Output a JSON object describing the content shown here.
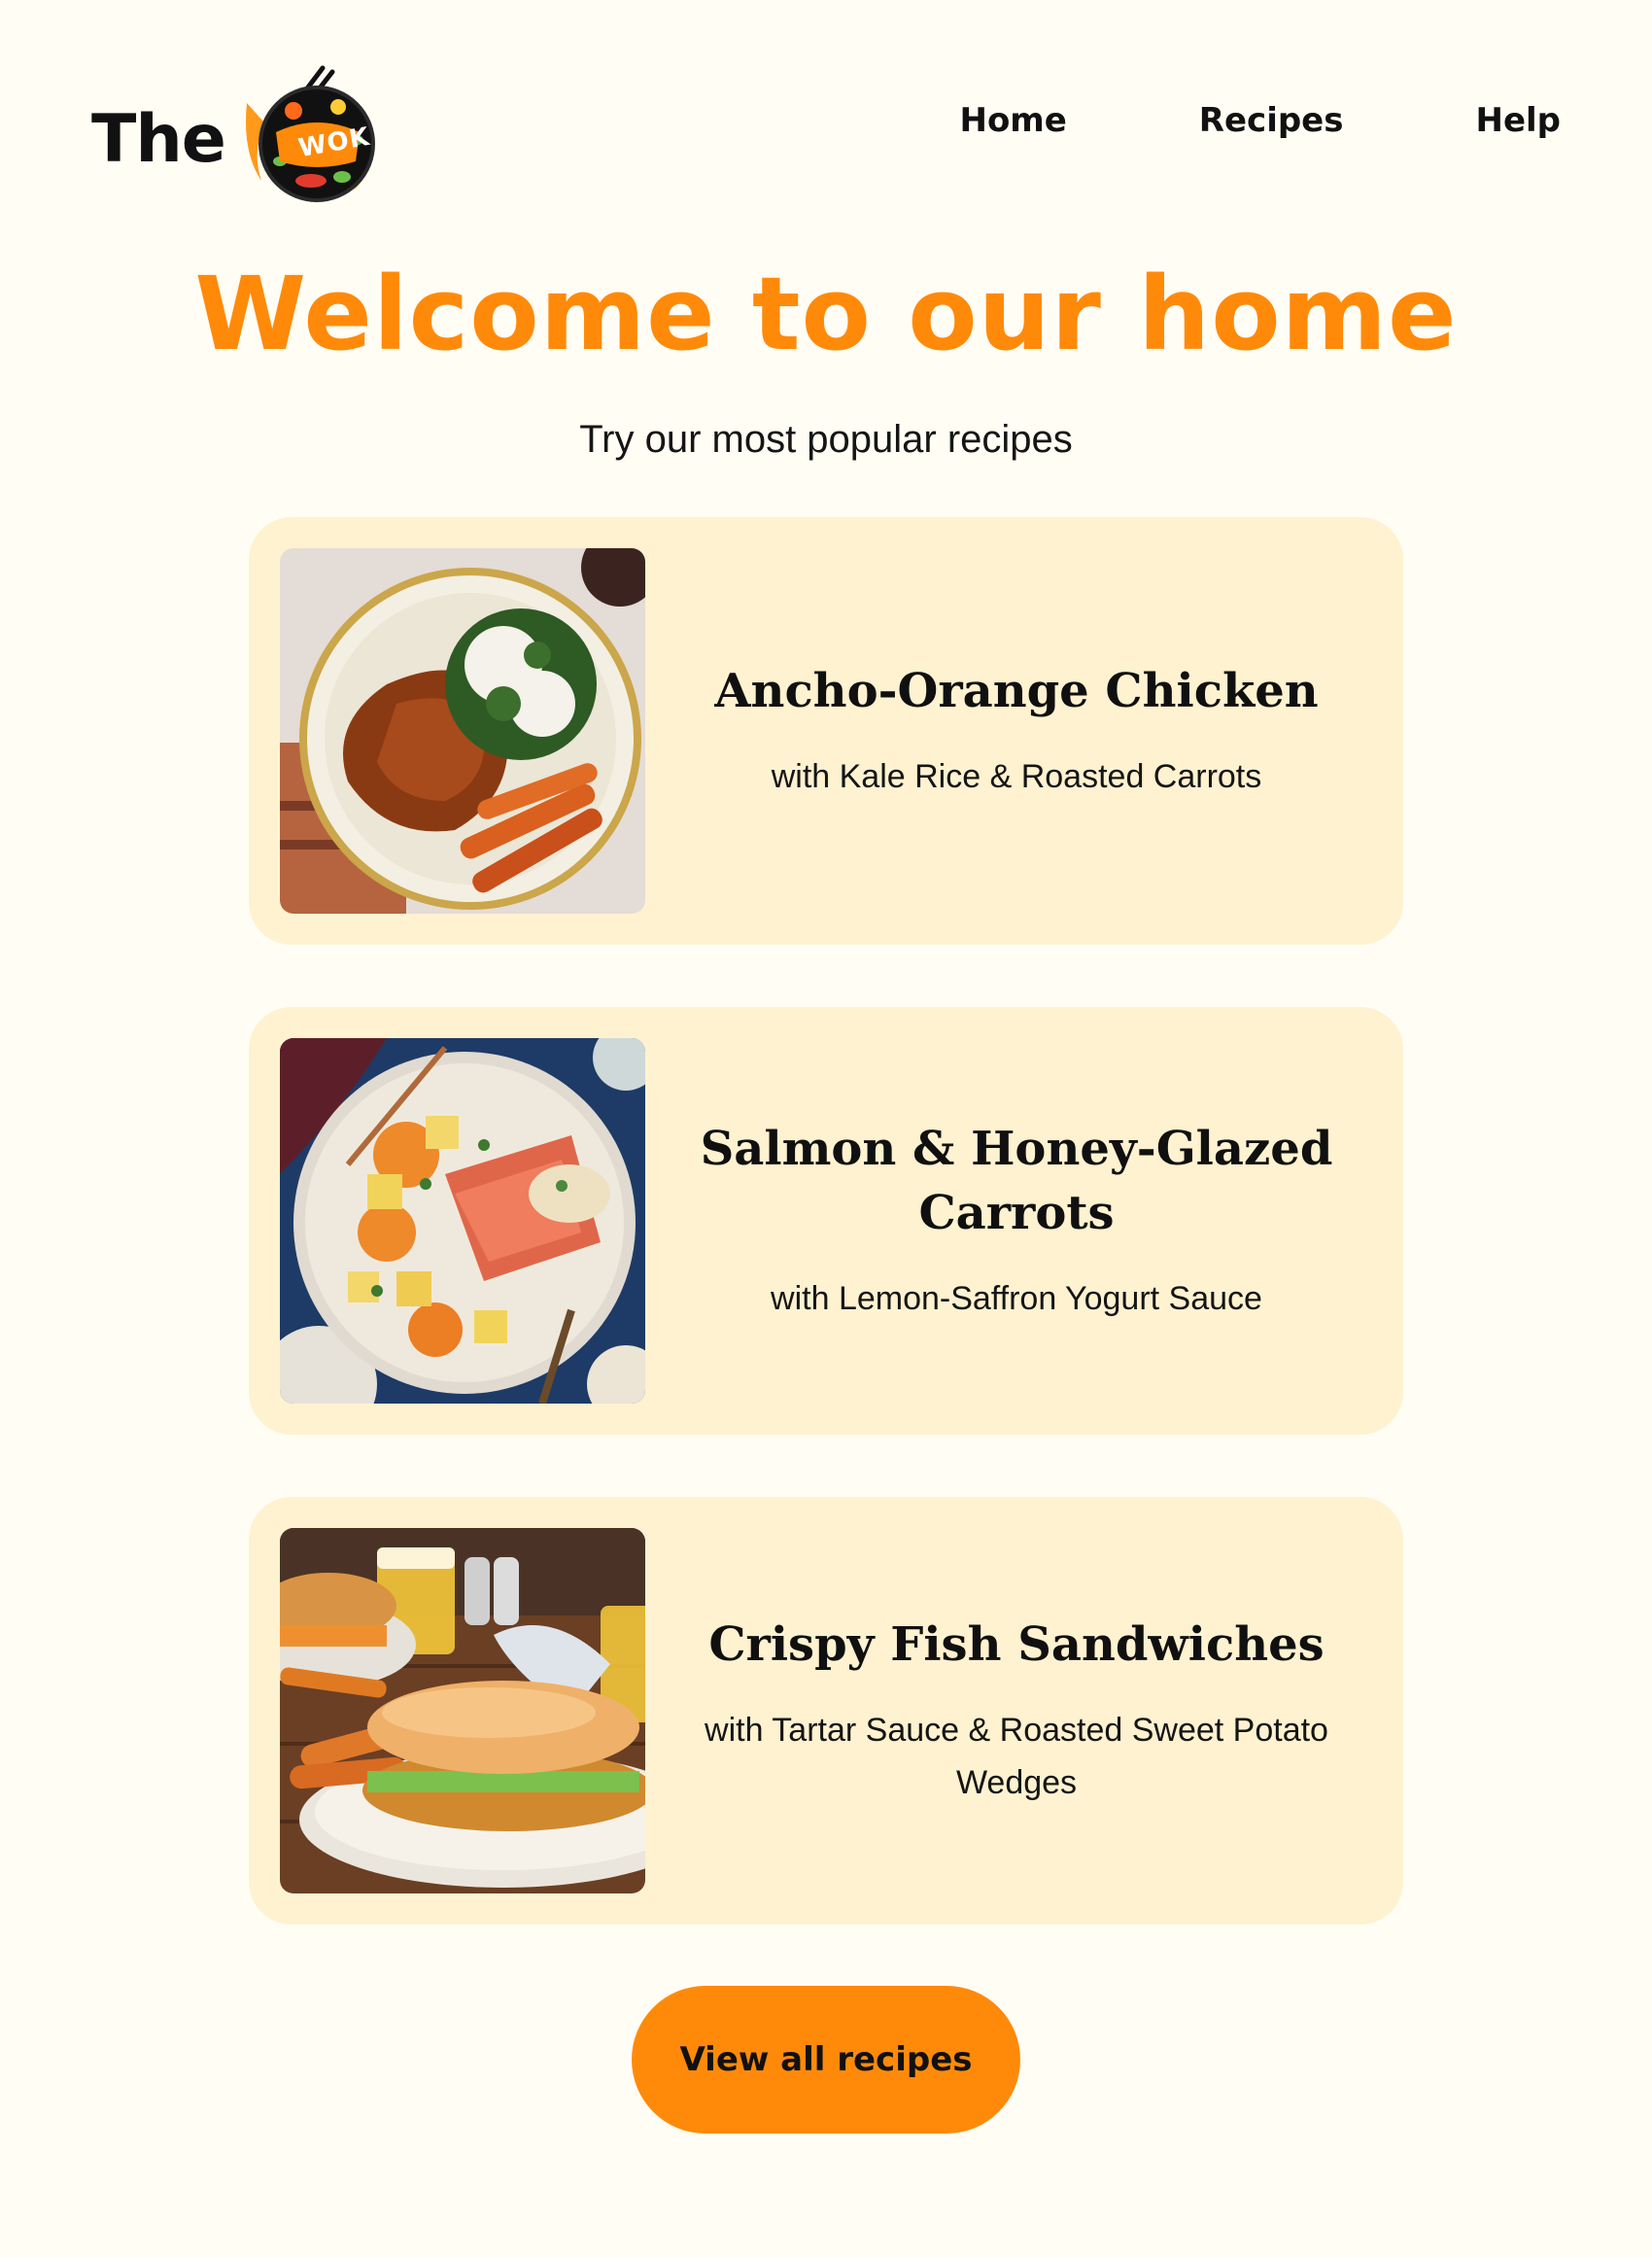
{
  "header": {
    "logo_prefix": "The",
    "logo_badge_text": "WOK",
    "nav": [
      {
        "label": "Home"
      },
      {
        "label": "Recipes"
      },
      {
        "label": "Help"
      }
    ]
  },
  "hero": {
    "title": "Welcome to our home",
    "subtitle": "Try our most popular recipes"
  },
  "recipes": [
    {
      "title": "Ancho-Orange Chicken",
      "description": "with Kale Rice & Roasted Carrots"
    },
    {
      "title": "Salmon & Honey-Glazed Carrots",
      "description": "with Lemon-Saffron Yogurt Sauce"
    },
    {
      "title": "Crispy Fish Sandwiches",
      "description": "with Tartar Sauce & Roasted Sweet Potato Wedges"
    }
  ],
  "cta": {
    "label": "View all recipes"
  },
  "colors": {
    "accent": "#ff8a0a",
    "background": "#fffdf4",
    "card": "#fff2d0",
    "text": "#111111"
  }
}
